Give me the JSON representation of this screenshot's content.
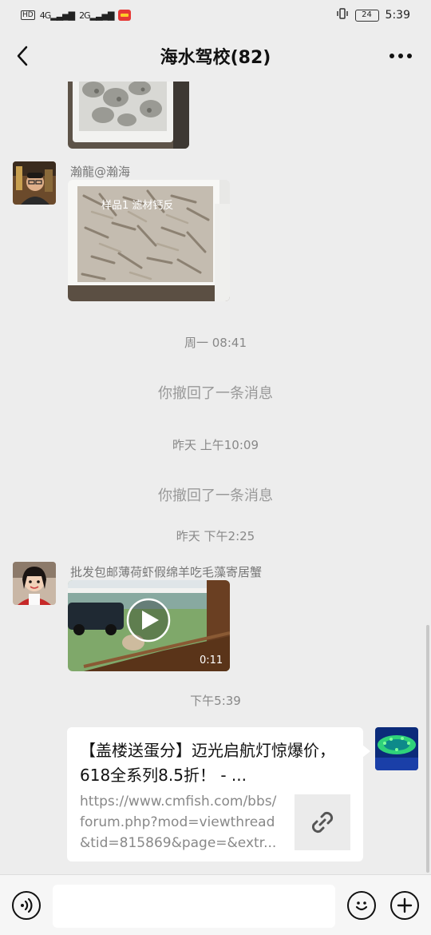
{
  "status_bar": {
    "network_1": "4G",
    "network_2": "2G",
    "battery": "24",
    "time": "5:39"
  },
  "header": {
    "title": "海水驾校(82)"
  },
  "messages": {
    "sender_1": "瀚龍@瀚海",
    "photo_caption": "样品1  滤材钙反",
    "time_1": "周一 08:41",
    "recall_1": "你撤回了一条消息",
    "time_2": "昨天 上午10:09",
    "recall_2": "你撤回了一条消息",
    "time_3": "昨天 下午2:25",
    "sender_2": "批发包邮薄荷虾假绵羊吃毛藻寄居蟹",
    "video_duration": "0:11",
    "time_4": "下午5:39"
  },
  "link_card": {
    "title": "【盖楼送蛋分】迈光启航灯惊爆价，618全系列8.5折！ - ...",
    "url": "https://www.cmfish.com/bbs/forum.php?mod=viewthread&tid=815869&page=&extr..."
  },
  "icons": {
    "back": "chevron-left-icon",
    "more": "more-dots-icon",
    "voice": "voice-icon",
    "emoji": "emoji-icon",
    "plus": "plus-icon",
    "link": "link-icon",
    "play": "play-icon"
  }
}
